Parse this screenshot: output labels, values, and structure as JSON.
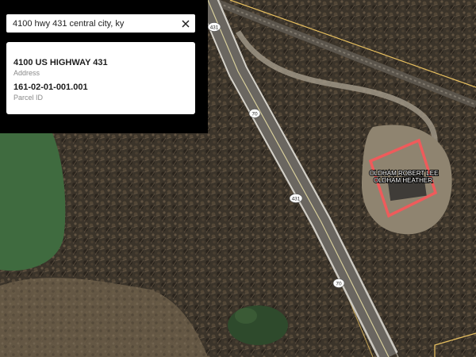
{
  "search": {
    "value": "4100 hwy 431 central city, ky"
  },
  "result": {
    "address": "4100 US HIGHWAY 431",
    "address_label": "Address",
    "parcel_id": "161-02-01-001.001",
    "parcel_label": "Parcel ID"
  },
  "map": {
    "road_shields": [
      "431",
      "70",
      "431",
      "70"
    ],
    "parcel_owner_lines": [
      "OLDHAM ROBERT LEE",
      "OLDHAM HEATHER"
    ],
    "colors": {
      "highlight": "#ef5b5b",
      "parcel_line": "#e8c060",
      "road": "#c9c6bf",
      "water": "#3f6b3f"
    }
  }
}
